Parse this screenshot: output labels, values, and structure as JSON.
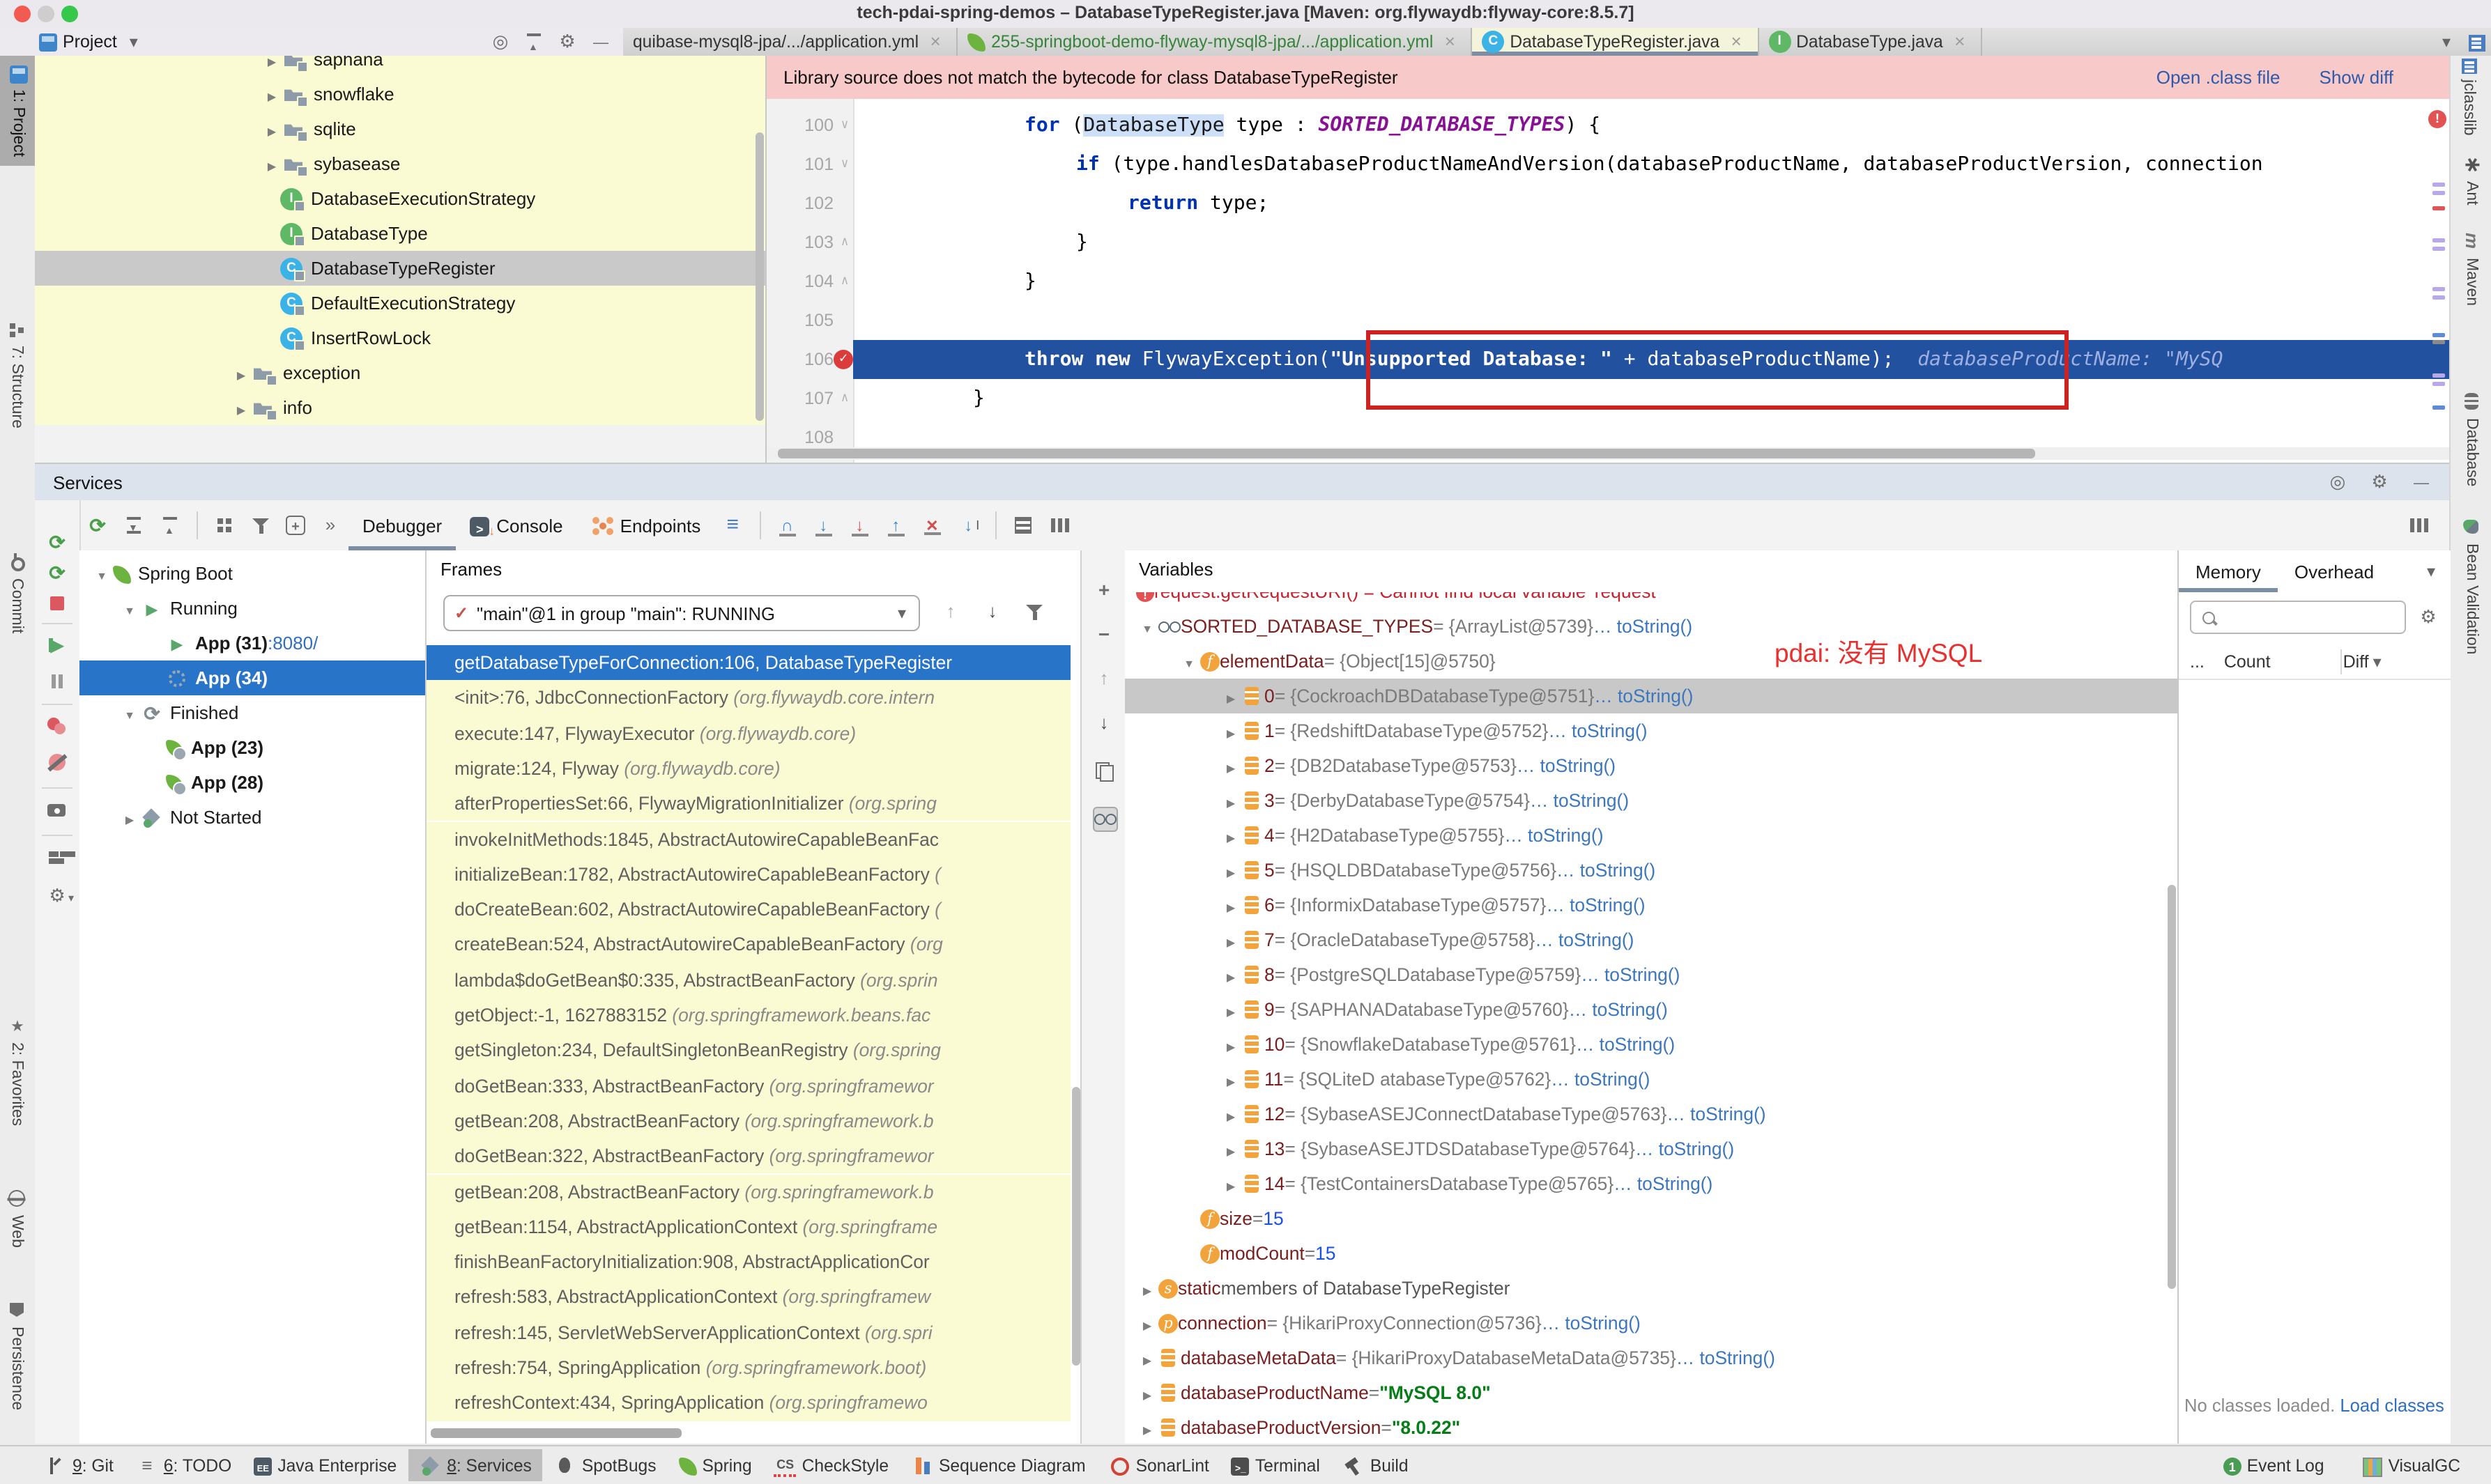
{
  "window": {
    "title": "tech-pdai-spring-demos – DatabaseTypeRegister.java [Maven: org.flywaydb:flyway-core:8.5.7]"
  },
  "project_header": {
    "title": "Project"
  },
  "tabs": {
    "items": [
      {
        "label": "quibase-mysql8-jpa/.../application.yml",
        "icon": "none",
        "active": false,
        "color": "#333333"
      },
      {
        "label": "255-springboot-demo-flyway-mysql8-jpa/.../application.yml",
        "icon": "spring",
        "active": false,
        "color": "#368439"
      },
      {
        "label": "DatabaseTypeRegister.java",
        "icon": "class",
        "active": true,
        "color": "#333333"
      },
      {
        "label": "DatabaseType.java",
        "icon": "interface",
        "active": false,
        "color": "#333333"
      }
    ]
  },
  "banner": {
    "message": "Library source does not match the bytecode for class DatabaseTypeRegister",
    "actions": [
      "Open .class file",
      "Show diff"
    ]
  },
  "project_tree": {
    "items": [
      {
        "depth": 2,
        "type": "folder",
        "label": "saphana",
        "chevron": true
      },
      {
        "depth": 2,
        "type": "folder",
        "label": "snowflake",
        "chevron": true
      },
      {
        "depth": 2,
        "type": "folder",
        "label": "sqlite",
        "chevron": true
      },
      {
        "depth": 2,
        "type": "folder",
        "label": "sybasease",
        "chevron": true
      },
      {
        "depth": 2,
        "type": "interface",
        "label": "DatabaseExecutionStrategy"
      },
      {
        "depth": 2,
        "type": "interface",
        "label": "DatabaseType"
      },
      {
        "depth": 2,
        "type": "class",
        "label": "DatabaseTypeRegister",
        "selected": true
      },
      {
        "depth": 2,
        "type": "class",
        "label": "DefaultExecutionStrategy"
      },
      {
        "depth": 2,
        "type": "class",
        "label": "InsertRowLock"
      },
      {
        "depth": 1,
        "type": "folder",
        "label": "exception",
        "chevron": true
      },
      {
        "depth": 1,
        "type": "folder",
        "label": "info",
        "chevron": true
      }
    ]
  },
  "editor": {
    "lines": [
      {
        "num": "100",
        "indent": 2,
        "fold": "down",
        "tokens": [
          {
            "t": "kw",
            "s": "for"
          },
          {
            "t": "p",
            "s": " ("
          },
          {
            "t": "hl",
            "s": "DatabaseType"
          },
          {
            "t": "p",
            "s": " type : "
          },
          {
            "t": "st",
            "s": "SORTED_DATABASE_TYPES"
          },
          {
            "t": "p",
            "s": ") {"
          }
        ]
      },
      {
        "num": "101",
        "indent": 3,
        "fold": "down",
        "tokens": [
          {
            "t": "kw",
            "s": "if"
          },
          {
            "t": "p",
            "s": " (type.handlesDatabaseProductNameAndVersion(databaseProductName, databaseProductVersion, connection"
          }
        ]
      },
      {
        "num": "102",
        "indent": 4,
        "tokens": [
          {
            "t": "kw",
            "s": "return"
          },
          {
            "t": "p",
            "s": " type;"
          }
        ]
      },
      {
        "num": "103",
        "indent": 3,
        "fold": "up",
        "tokens": [
          {
            "t": "p",
            "s": "}"
          }
        ]
      },
      {
        "num": "104",
        "indent": 2,
        "fold": "up",
        "tokens": [
          {
            "t": "p",
            "s": "}"
          }
        ]
      },
      {
        "num": "105",
        "indent": 0,
        "tokens": []
      },
      {
        "num": "106",
        "indent": 2,
        "exec": true,
        "breakpoint": true,
        "tokens": [
          {
            "t": "kw",
            "s": "throw new"
          },
          {
            "t": "p",
            "s": " FlywayException("
          },
          {
            "t": "str",
            "s": "\"Unsupported Database: \""
          },
          {
            "t": "p",
            "s": " + databaseProductName);"
          }
        ],
        "hint": "databaseProductName: \"MySQ"
      },
      {
        "num": "107",
        "indent": 1,
        "fold": "up",
        "tokens": [
          {
            "t": "p",
            "s": "}"
          }
        ]
      },
      {
        "num": "108",
        "indent": 0,
        "tokens": []
      }
    ]
  },
  "services": {
    "title": "Services",
    "tabs": [
      {
        "label": "Debugger",
        "selected": true,
        "icon": null
      },
      {
        "label": "Console",
        "selected": false,
        "icon": "console"
      },
      {
        "label": "Endpoints",
        "selected": false,
        "icon": "endpoints"
      }
    ],
    "tree": [
      {
        "depth": 0,
        "icon": "leaf",
        "label": "Spring Boot",
        "chevron": "down"
      },
      {
        "depth": 1,
        "icon": "play",
        "label": "Running",
        "chevron": "down"
      },
      {
        "depth": 2,
        "icon": "play",
        "label": "App (31)",
        "suffix": " :8080/",
        "bold": true
      },
      {
        "depth": 2,
        "icon": "spinner",
        "label": "App (34)",
        "bold": true,
        "selected": true
      },
      {
        "depth": 1,
        "icon": "rerun-gray",
        "label": "Finished",
        "chevron": "down"
      },
      {
        "depth": 2,
        "icon": "leaf-badge",
        "label": "App (23)",
        "bold": true
      },
      {
        "depth": 2,
        "icon": "leaf-badge",
        "label": "App (28)",
        "bold": true
      },
      {
        "depth": 1,
        "icon": "svcstat",
        "label": "Not Started",
        "chevron": "right"
      }
    ]
  },
  "frames": {
    "header": "Frames",
    "thread_dropdown": "\"main\"@1 in group \"main\": RUNNING",
    "items": [
      {
        "m": "getDatabaseTypeForConnection:106, DatabaseTypeRegister",
        "p": "",
        "selected": true
      },
      {
        "m": "<init>:76, JdbcConnectionFactory",
        "p": " (org.flywaydb.core.intern"
      },
      {
        "m": "execute:147, FlywayExecutor",
        "p": " (org.flywaydb.core)"
      },
      {
        "m": "migrate:124, Flyway",
        "p": " (org.flywaydb.core)"
      },
      {
        "m": "afterPropertiesSet:66, FlywayMigrationInitializer",
        "p": " (org.spring"
      },
      {
        "m": "invokeInitMethods:1845, AbstractAutowireCapableBeanFac",
        "p": ""
      },
      {
        "m": "initializeBean:1782, AbstractAutowireCapableBeanFactory",
        "p": " ("
      },
      {
        "m": "doCreateBean:602, AbstractAutowireCapableBeanFactory",
        "p": " ("
      },
      {
        "m": "createBean:524, AbstractAutowireCapableBeanFactory",
        "p": " (org"
      },
      {
        "m": "lambda$doGetBean$0:335, AbstractBeanFactory",
        "p": " (org.sprin"
      },
      {
        "m": "getObject:-1, 1627883152",
        "p": " (org.springframework.beans.fac"
      },
      {
        "m": "getSingleton:234, DefaultSingletonBeanRegistry",
        "p": " (org.spring"
      },
      {
        "m": "doGetBean:333, AbstractBeanFactory",
        "p": " (org.springframewor"
      },
      {
        "m": "getBean:208, AbstractBeanFactory",
        "p": " (org.springframework.b"
      },
      {
        "m": "doGetBean:322, AbstractBeanFactory",
        "p": " (org.springframewor"
      },
      {
        "m": "getBean:208, AbstractBeanFactory",
        "p": " (org.springframework.b"
      },
      {
        "m": "getBean:1154, AbstractApplicationContext",
        "p": " (org.springframe"
      },
      {
        "m": "finishBeanFactoryInitialization:908, AbstractApplicationCor",
        "p": ""
      },
      {
        "m": "refresh:583, AbstractApplicationContext",
        "p": " (org.springframew"
      },
      {
        "m": "refresh:145, ServletWebServerApplicationContext",
        "p": " (org.spri"
      },
      {
        "m": "refresh:754, SpringApplication",
        "p": " (org.springframework.boot)"
      },
      {
        "m": "refreshContext:434, SpringApplication",
        "p": " (org.springframewo"
      }
    ]
  },
  "variables": {
    "header": "Variables",
    "items": [
      {
        "kind": "error",
        "error_text": "request.getRequestURI() = Cannot find local variable 'request'",
        "depth": 0,
        "clipped": true
      },
      {
        "kind": "watch",
        "arrow": "down",
        "name": "SORTED_DATABASE_TYPES",
        "value": "{ArrayList@5739}",
        "link": "… toString()",
        "depth": 0
      },
      {
        "kind": "f",
        "arrow": "down",
        "name": "elementData",
        "value": "{Object[15]@5750}",
        "depth": 1
      },
      {
        "kind": "arr",
        "arrow": "right",
        "name": "0",
        "value": "{CockroachDBDatabaseType@5751}",
        "link": "… toString()",
        "depth": 2,
        "selected": true
      },
      {
        "kind": "arr",
        "arrow": "right",
        "name": "1",
        "value": "{RedshiftDatabaseType@5752}",
        "link": "… toString()",
        "depth": 2
      },
      {
        "kind": "arr",
        "arrow": "right",
        "name": "2",
        "value": "{DB2DatabaseType@5753}",
        "link": "… toString()",
        "depth": 2
      },
      {
        "kind": "arr",
        "arrow": "right",
        "name": "3",
        "value": "{DerbyDatabaseType@5754}",
        "link": "… toString()",
        "depth": 2
      },
      {
        "kind": "arr",
        "arrow": "right",
        "name": "4",
        "value": "{H2DatabaseType@5755}",
        "link": "… toString()",
        "depth": 2
      },
      {
        "kind": "arr",
        "arrow": "right",
        "name": "5",
        "value": "{HSQLDBDatabaseType@5756}",
        "link": "… toString()",
        "depth": 2
      },
      {
        "kind": "arr",
        "arrow": "right",
        "name": "6",
        "value": "{InformixDatabaseType@5757}",
        "link": "… toString()",
        "depth": 2
      },
      {
        "kind": "arr",
        "arrow": "right",
        "name": "7",
        "value": "{OracleDatabaseType@5758}",
        "link": "… toString()",
        "depth": 2
      },
      {
        "kind": "arr",
        "arrow": "right",
        "name": "8",
        "value": "{PostgreSQLDatabaseType@5759}",
        "link": "… toString()",
        "depth": 2
      },
      {
        "kind": "arr",
        "arrow": "right",
        "name": "9",
        "value": "{SAPHANADatabaseType@5760}",
        "link": "… toString()",
        "depth": 2
      },
      {
        "kind": "arr",
        "arrow": "right",
        "name": "10",
        "value": "{SnowflakeDatabaseType@5761}",
        "link": "… toString()",
        "depth": 2
      },
      {
        "kind": "arr",
        "arrow": "right",
        "name": "11",
        "value": "{SQLiteD atabaseType@5762}",
        "link": "… toString()",
        "depth": 2
      },
      {
        "kind": "arr",
        "arrow": "right",
        "name": "12",
        "value": "{SybaseASEJConnectDatabaseType@5763}",
        "link": "… toString()",
        "depth": 2
      },
      {
        "kind": "arr",
        "arrow": "right",
        "name": "13",
        "value": "{SybaseASEJTDSDatabaseType@5764}",
        "link": "… toString()",
        "depth": 2
      },
      {
        "kind": "arr",
        "arrow": "right",
        "name": "14",
        "value": "{TestContainersDatabaseType@5765}",
        "link": "… toString()",
        "depth": 2
      },
      {
        "kind": "f",
        "name": "size",
        "num": "15",
        "depth": 1
      },
      {
        "kind": "f",
        "name": "modCount",
        "num": "15",
        "depth": 1
      },
      {
        "kind": "s",
        "arrow": "right",
        "name": "static",
        "plain_tail": " members of DatabaseTypeRegister",
        "depth": 0
      },
      {
        "kind": "p",
        "arrow": "right",
        "name": "connection",
        "value": "{HikariProxyConnection@5736}",
        "link": "… toString()",
        "depth": 0
      },
      {
        "kind": "arr",
        "arrow": "right",
        "name": "databaseMetaData",
        "value": "{HikariProxyDatabaseMetaData@5735}",
        "link": "… toString()",
        "depth": 0
      },
      {
        "kind": "arr",
        "arrow": "right",
        "name": "databaseProductName",
        "strval": "\"MySQL 8.0\"",
        "depth": 0
      },
      {
        "kind": "arr",
        "arrow": "right",
        "name": "databaseProductVersion",
        "strval": "\"8.0.22\"",
        "depth": 0
      }
    ],
    "annotation": "pdai: 没有 MySQL"
  },
  "memory": {
    "tabs": [
      {
        "label": "Memory",
        "selected": true
      },
      {
        "label": "Overhead",
        "selected": false
      }
    ],
    "columns": [
      "...",
      "Count",
      "Diff"
    ],
    "empty_text": "No classes loaded.",
    "empty_link": "Load classes"
  },
  "status_bar": {
    "left": [
      {
        "label": "9: Git",
        "icon": "git",
        "underline": "9"
      },
      {
        "label": "6: TODO",
        "icon": "todo",
        "underline": "6"
      },
      {
        "label": "Java Enterprise",
        "icon": "javaee"
      },
      {
        "label": "8: Services",
        "icon": "svcstat",
        "underline": "8",
        "selected": true
      },
      {
        "label": "SpotBugs",
        "icon": "bug"
      },
      {
        "label": "Spring",
        "icon": "leaf"
      },
      {
        "label": "CheckStyle",
        "icon": "cs"
      },
      {
        "label": "Sequence Diagram",
        "icon": "seq"
      },
      {
        "label": "SonarLint",
        "icon": "sonar"
      },
      {
        "label": "Terminal",
        "icon": "terminal"
      },
      {
        "label": "Build",
        "icon": "build"
      }
    ],
    "right": [
      {
        "label": "Event Log",
        "icon": "event"
      },
      {
        "label": "VisualGC",
        "icon": "vgc"
      }
    ]
  },
  "stripes": {
    "left_top": [
      {
        "label": "1: Project",
        "icon": "projpane",
        "selected": true
      },
      {
        "label": "7: Structure",
        "icon": "struct"
      },
      {
        "label": "Commit",
        "icon": "commit"
      }
    ],
    "left_bottom": [
      {
        "label": "2: Favorites",
        "icon": "star"
      },
      {
        "label": "Web",
        "icon": "web"
      },
      {
        "label": "Persistence",
        "icon": "persist"
      }
    ],
    "right": [
      {
        "label": "jclasslib",
        "icon": "jcl"
      },
      {
        "label": "Ant",
        "icon": "ant"
      },
      {
        "label": "Maven",
        "icon": "maven"
      },
      {
        "label": "Database",
        "icon": "db"
      },
      {
        "label": "Bean Validation",
        "icon": "bean"
      }
    ]
  },
  "colors": {
    "exec_line": "#21519F",
    "banner_bg": "#F7C9C9",
    "annotation_red": "#CC2222",
    "selection_blue": "#2874C9",
    "tab_green": "#368439",
    "link_blue": "#2E5AAC",
    "yellow_bg": "#FBFBD3"
  }
}
